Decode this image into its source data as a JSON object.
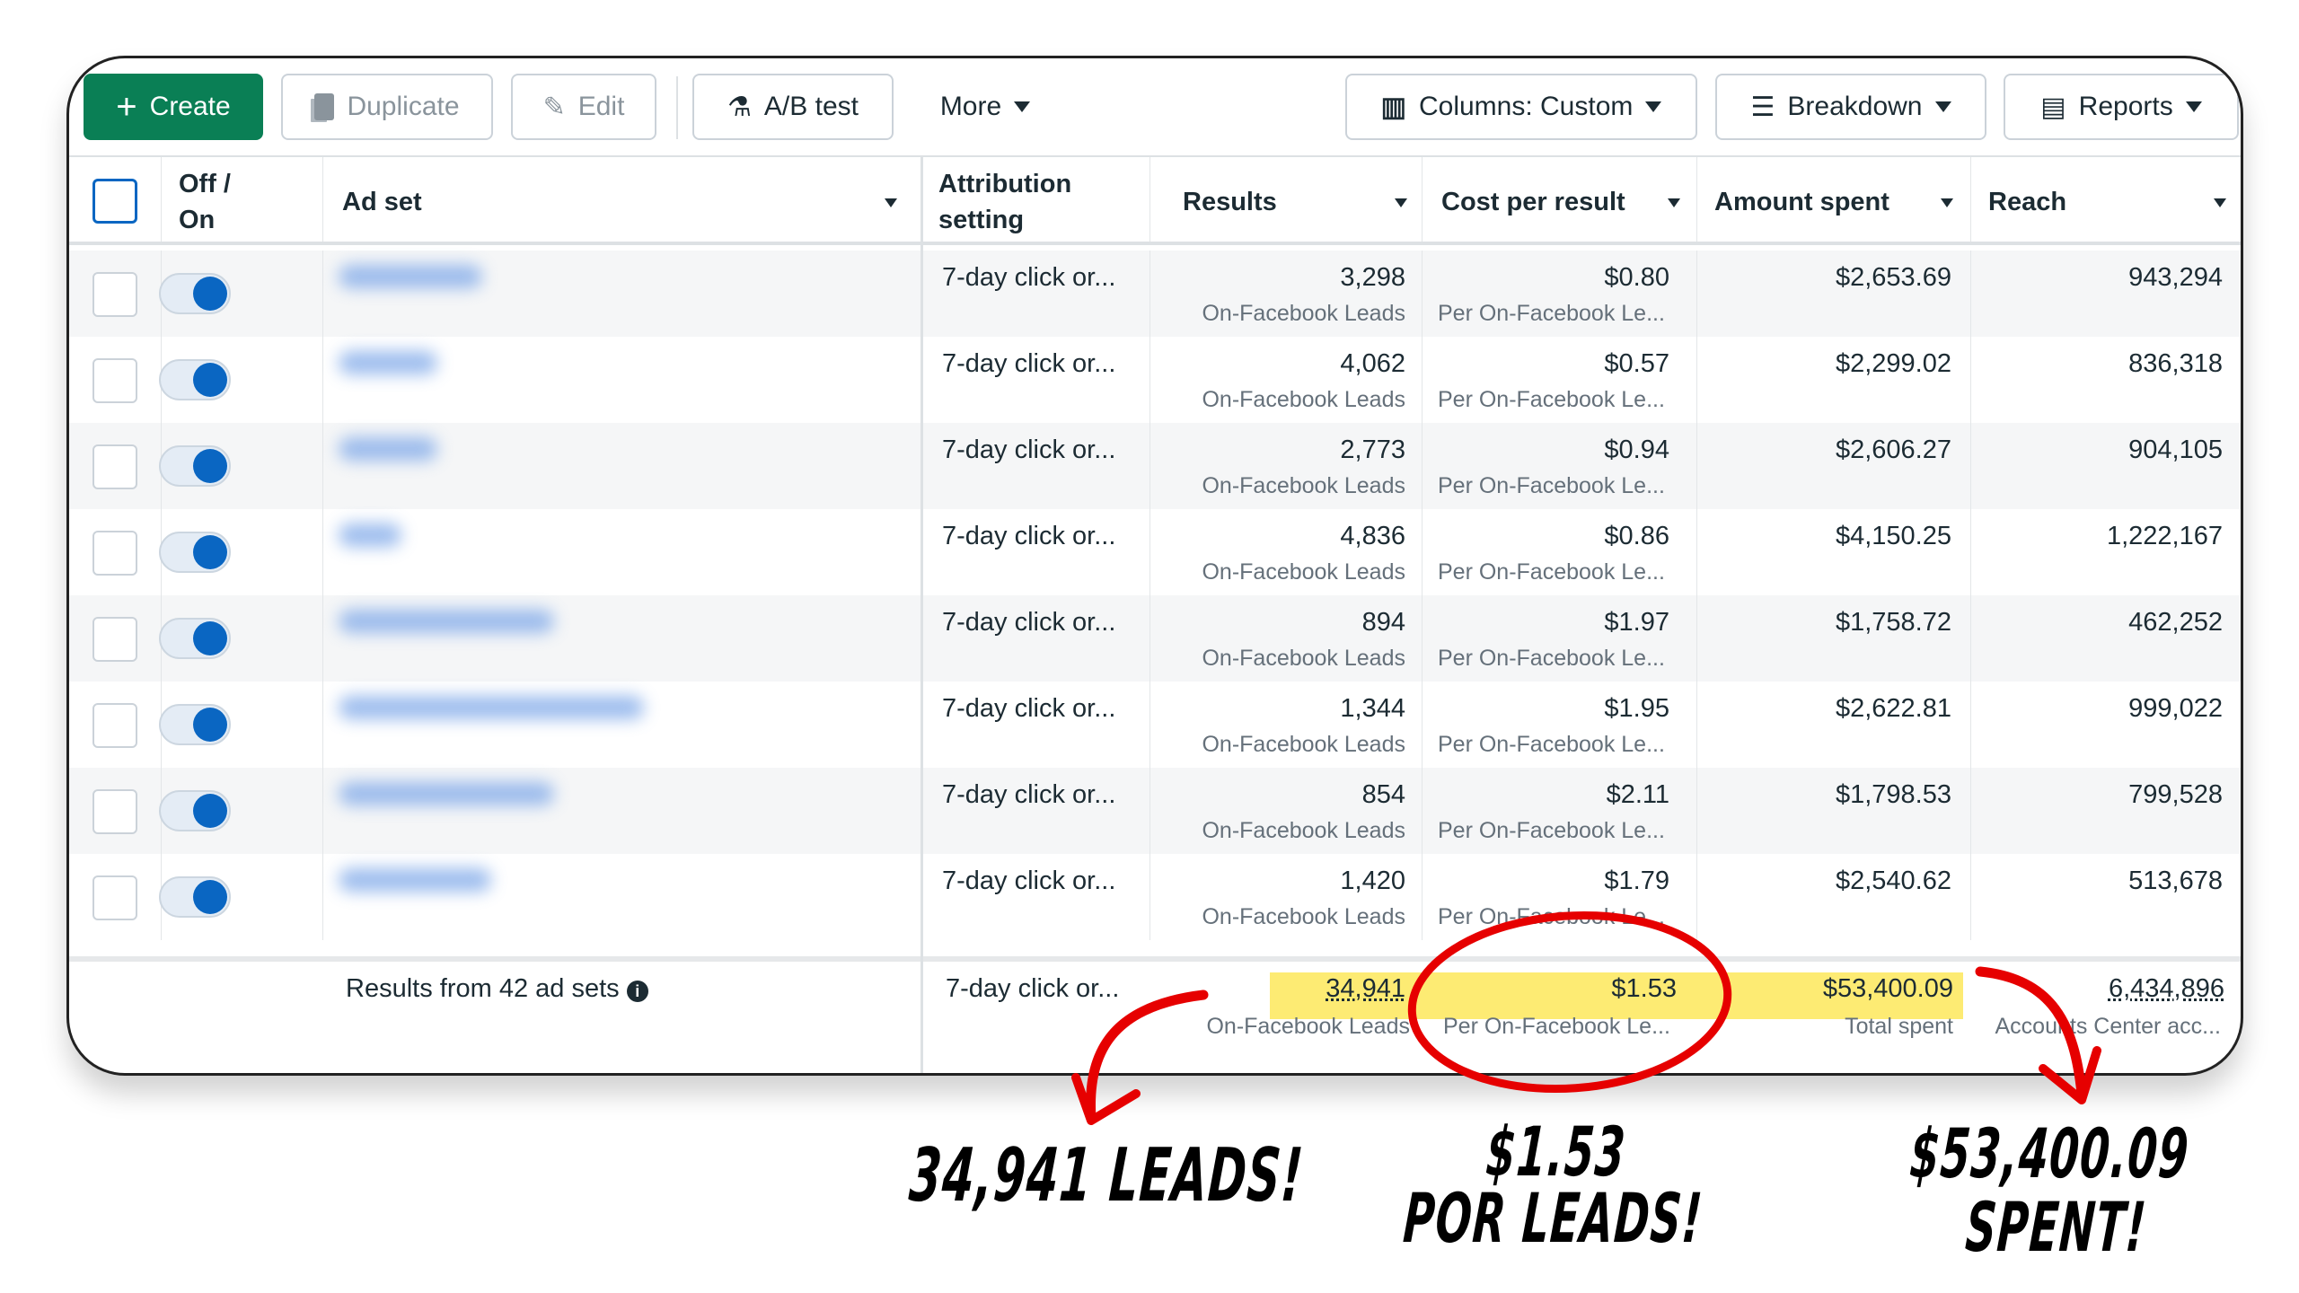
{
  "toolbar": {
    "create": "Create",
    "duplicate": "Duplicate",
    "edit": "Edit",
    "ab_test": "A/B test",
    "more": "More",
    "columns": "Columns: Custom",
    "breakdown": "Breakdown",
    "reports": "Reports"
  },
  "headers": {
    "off_on_1": "Off /",
    "off_on_2": "On",
    "ad_set": "Ad set",
    "attribution_1": "Attribution",
    "attribution_2": "setting",
    "results": "Results",
    "cost": "Cost per result",
    "amount": "Amount spent",
    "reach": "Reach"
  },
  "rows": [
    {
      "attribution": "7-day click or...",
      "results": "3,298",
      "results_sub": "On-Facebook Leads",
      "cost": "$0.80",
      "cost_sub": "Per On-Facebook Le...",
      "amount": "$2,653.69",
      "reach": "943,294"
    },
    {
      "attribution": "7-day click or...",
      "results": "4,062",
      "results_sub": "On-Facebook Leads",
      "cost": "$0.57",
      "cost_sub": "Per On-Facebook Le...",
      "amount": "$2,299.02",
      "reach": "836,318"
    },
    {
      "attribution": "7-day click or...",
      "results": "2,773",
      "results_sub": "On-Facebook Leads",
      "cost": "$0.94",
      "cost_sub": "Per On-Facebook Le...",
      "amount": "$2,606.27",
      "reach": "904,105"
    },
    {
      "attribution": "7-day click or...",
      "results": "4,836",
      "results_sub": "On-Facebook Leads",
      "cost": "$0.86",
      "cost_sub": "Per On-Facebook Le...",
      "amount": "$4,150.25",
      "reach": "1,222,167"
    },
    {
      "attribution": "7-day click or...",
      "results": "894",
      "results_sub": "On-Facebook Leads",
      "cost": "$1.97",
      "cost_sub": "Per On-Facebook Le...",
      "amount": "$1,758.72",
      "reach": "462,252"
    },
    {
      "attribution": "7-day click or...",
      "results": "1,344",
      "results_sub": "On-Facebook Leads",
      "cost": "$1.95",
      "cost_sub": "Per On-Facebook Le...",
      "amount": "$2,622.81",
      "reach": "999,022"
    },
    {
      "attribution": "7-day click or...",
      "results": "854",
      "results_sub": "On-Facebook Leads",
      "cost": "$2.11",
      "cost_sub": "Per On-Facebook Le...",
      "amount": "$1,798.53",
      "reach": "799,528"
    },
    {
      "attribution": "7-day click or...",
      "results": "1,420",
      "results_sub": "On-Facebook Leads",
      "cost": "$1.79",
      "cost_sub": "Per On-Facebook Le...",
      "amount": "$2,540.62",
      "reach": "513,678"
    }
  ],
  "totals": {
    "label": "Results from 42 ad sets",
    "attribution": "7-day click or...",
    "results": "34,941",
    "results_sub": "On-Facebook Leads",
    "cost": "$1.53",
    "cost_sub": "Per On-Facebook Le...",
    "amount": "$53,400.09",
    "amount_sub": "Total spent",
    "reach": "6,434,896",
    "reach_sub": "Accounts Center acc..."
  },
  "annotations": {
    "leads": "34,941 LEADS!",
    "cost_1": "$1.53",
    "cost_2": "POR LEADS!",
    "spent_1": "$53,400.09",
    "spent_2": "SPENT!"
  },
  "colors": {
    "create": "#0a7f55",
    "toggle": "#0a66c2",
    "highlight": "#fdeb73",
    "annotation": "#e60000"
  }
}
